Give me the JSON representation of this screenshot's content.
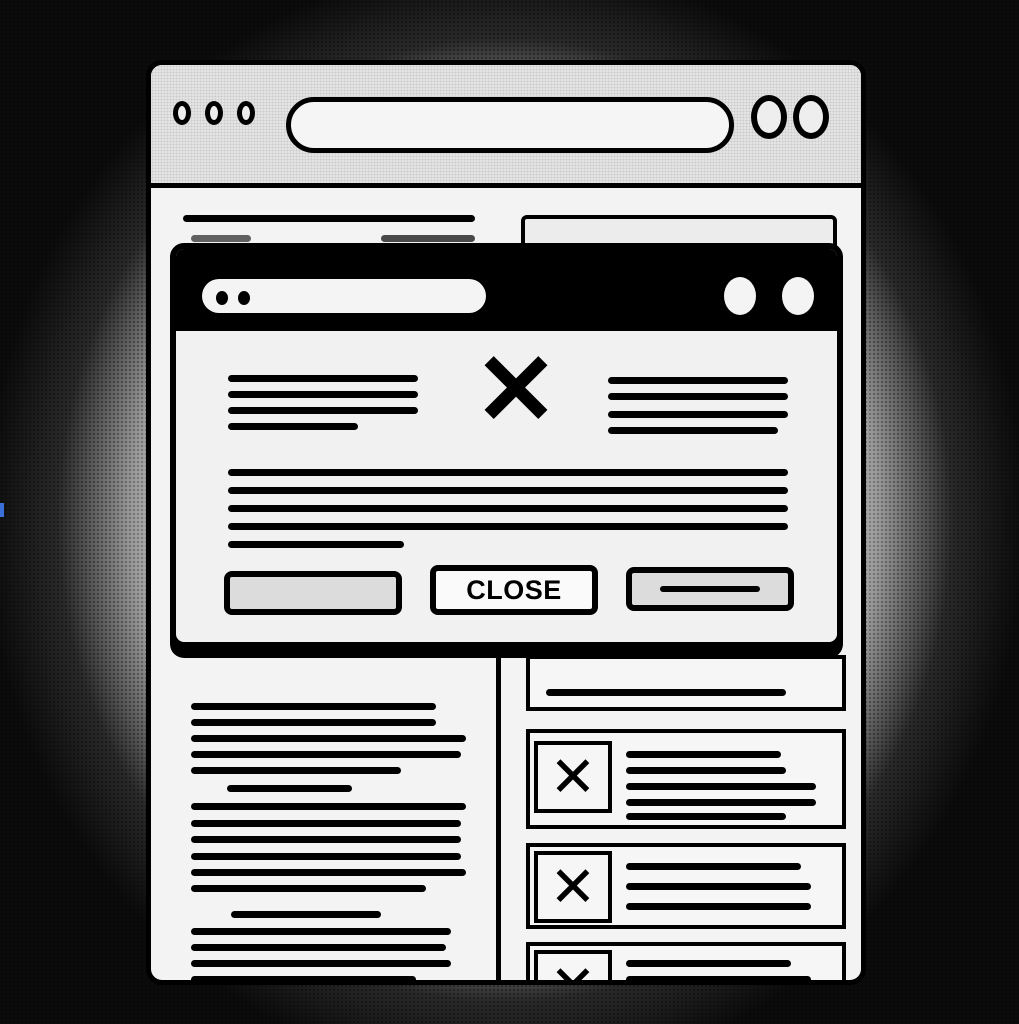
{
  "browser": {
    "url_value": "",
    "traffic_lights": [
      "dot",
      "dot",
      "dot"
    ],
    "window_controls": [
      "circle",
      "circle"
    ]
  },
  "dialog": {
    "url_value": "",
    "icon": "x-icon",
    "icon_glyph": "✕",
    "buttons": [
      {
        "label": ""
      },
      {
        "label": "CLOSE"
      },
      {
        "label": ""
      }
    ]
  },
  "list": {
    "items": [
      {
        "checked": true,
        "glyph": "✕"
      },
      {
        "checked": true,
        "glyph": "✕"
      },
      {
        "checked": true,
        "glyph": "✕"
      }
    ]
  },
  "colors": {
    "ink": "#000000",
    "paper": "#f3f3f3",
    "background": "#0b0b0b"
  }
}
